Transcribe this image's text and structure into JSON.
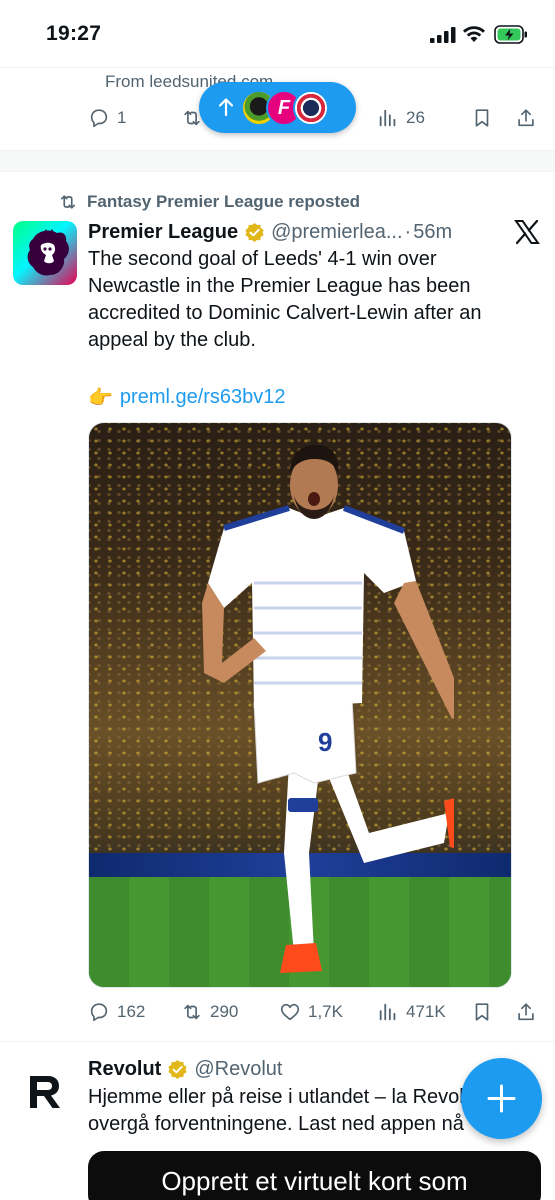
{
  "status_bar": {
    "time": "19:27"
  },
  "previous_post": {
    "source_text": "From leedsunited.com",
    "actions": {
      "replies": "1",
      "views": "26"
    }
  },
  "new_posts_pill": {
    "avatars": [
      "FPL Manager",
      "F",
      "Premier League fan"
    ]
  },
  "post": {
    "repost_label": "Fantasy Premier League reposted",
    "author_name": "Premier League",
    "handle": "@premierlea...",
    "time": "56m",
    "separator": "·",
    "text": "The second goal of Leeds' 4-1 win over Newcastle in the Premier League has been accredited to Dominic Calvert-Lewin after an appeal by the club.",
    "link_emoji": "👉",
    "link": "preml.ge/rs63bv12",
    "player_number": "9",
    "stats": {
      "replies": "162",
      "reposts": "290",
      "likes": "1,7K",
      "views": "471K"
    }
  },
  "ad_post": {
    "author_name": "Revolut",
    "handle": "@Revolut",
    "line1": "Hjemme eller på reise i utlandet – la Revolut",
    "line2": "overgå forventningene. Last ned appen nå",
    "media_caption": "Opprett et virtuelt kort som"
  },
  "colors": {
    "accent": "#1d9bf0",
    "secondary_text": "#536471",
    "verified_gold": "#e2b719"
  },
  "icons": [
    "reply-icon",
    "repost-icon",
    "like-icon",
    "views-icon",
    "bookmark-icon",
    "share-icon",
    "x-logo-icon",
    "verified-badge-icon",
    "compose-plus-icon"
  ]
}
